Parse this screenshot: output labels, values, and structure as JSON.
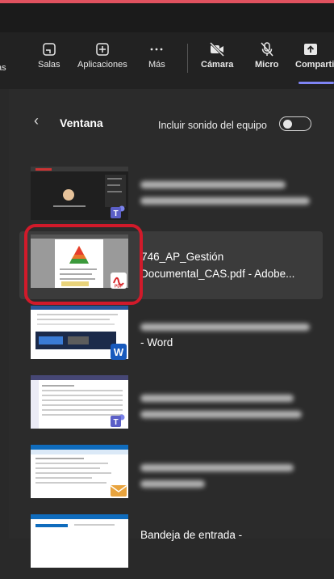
{
  "toolbar": {
    "items": [
      {
        "label": "as",
        "icon": "partial-icon"
      },
      {
        "label": "Salas",
        "icon": "rooms-icon"
      },
      {
        "label": "Aplicaciones",
        "icon": "apps-icon"
      },
      {
        "label": "Más",
        "icon": "more-icon"
      },
      {
        "label": "Cámara",
        "icon": "camera-off-icon"
      },
      {
        "label": "Micro",
        "icon": "mic-off-icon"
      },
      {
        "label": "Comparti",
        "icon": "share-icon"
      }
    ]
  },
  "panel": {
    "title": "Ventana",
    "sound_label": "Incluir sonido del equipo",
    "sound_enabled": false
  },
  "windows": [
    {
      "label_lines": [],
      "app": "teams"
    },
    {
      "label_lines": [
        " 746_AP_Gestión",
        "Documental_CAS.pdf - Adobe..."
      ],
      "app": "acrobat",
      "selected": true
    },
    {
      "label_lines": [
        "- Word"
      ],
      "app": "word"
    },
    {
      "label_lines": [],
      "app": "teams"
    },
    {
      "label_lines": [],
      "app": "outlook"
    },
    {
      "label_lines": [
        "Bandeja de entrada -"
      ],
      "app": "outlook"
    }
  ],
  "colors": {
    "accent": "#7f85f5",
    "highlight": "#d11a2a",
    "teams": "#5b5fc7",
    "word": "#185abd",
    "acrobat": "#d7262a",
    "outlook": "#e8a33d"
  }
}
